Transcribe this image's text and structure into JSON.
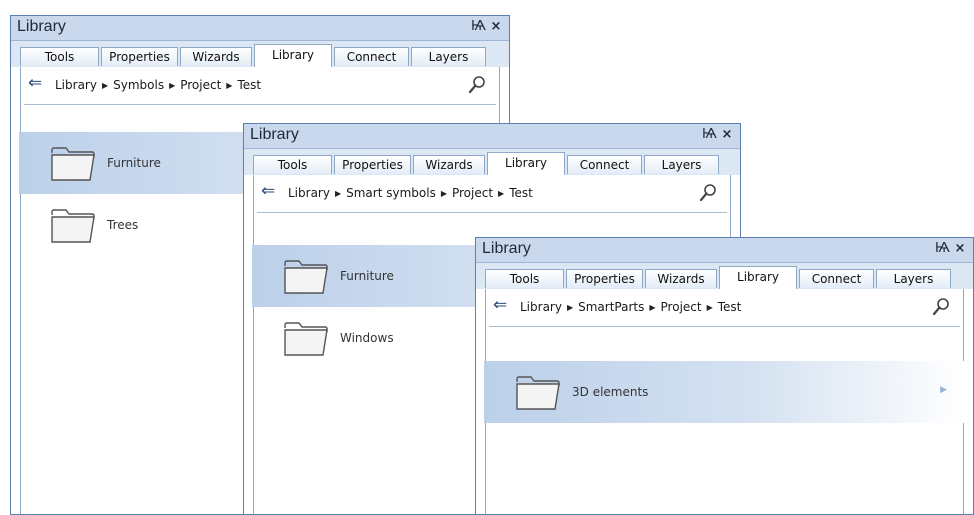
{
  "panels": [
    {
      "title": "Library",
      "pin_glyph": "Ѩ",
      "close_glyph": "×",
      "tabs": [
        "Tools",
        "Properties",
        "Wizards",
        "Library",
        "Connect",
        "Layers"
      ],
      "active_tab": "Library",
      "breadcrumb": [
        "Library",
        "Symbols",
        "Project",
        "Test"
      ],
      "items": [
        {
          "label": "Furniture",
          "selected": true
        },
        {
          "label": "Trees",
          "selected": false
        }
      ]
    },
    {
      "title": "Library",
      "pin_glyph": "Ѩ",
      "close_glyph": "×",
      "tabs": [
        "Tools",
        "Properties",
        "Wizards",
        "Library",
        "Connect",
        "Layers"
      ],
      "active_tab": "Library",
      "breadcrumb": [
        "Library",
        "Smart symbols",
        "Project",
        "Test"
      ],
      "items": [
        {
          "label": "Furniture",
          "selected": true
        },
        {
          "label": "Windows",
          "selected": false
        }
      ]
    },
    {
      "title": "Library",
      "pin_glyph": "Ѩ",
      "close_glyph": "×",
      "tabs": [
        "Tools",
        "Properties",
        "Wizards",
        "Library",
        "Connect",
        "Layers"
      ],
      "active_tab": "Library",
      "breadcrumb": [
        "Library",
        "SmartParts",
        "Project",
        "Test"
      ],
      "items": [
        {
          "label": "3D elements",
          "selected": true,
          "has_arrow": true
        }
      ]
    }
  ],
  "icons": {
    "back": "back-arrow-icon",
    "search": "search-icon",
    "folder": "folder-icon",
    "separator": "triangle-right-icon"
  },
  "colors": {
    "border": "#5b7fb0",
    "titlebar": "#c9d8ec",
    "tabstrip": "#dce7f4",
    "selected_item": "#bcd0ea"
  }
}
